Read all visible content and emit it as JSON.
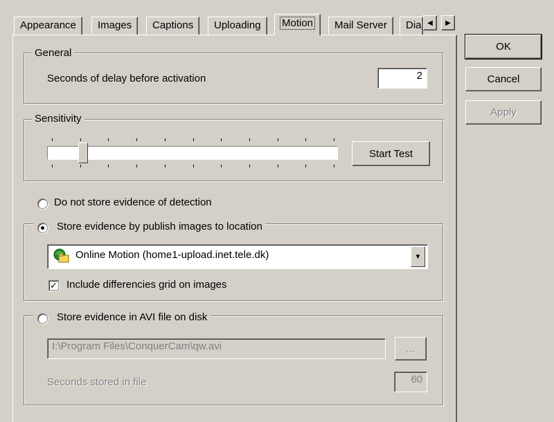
{
  "tabs": [
    {
      "label": "Appearance"
    },
    {
      "label": "Images"
    },
    {
      "label": "Captions"
    },
    {
      "label": "Uploading"
    },
    {
      "label": "Motion",
      "active": true
    },
    {
      "label": "Mail Server"
    },
    {
      "label": "Dia"
    }
  ],
  "tab_scroll": {
    "left_icon": "triangle-left-icon",
    "right_icon": "triangle-right-icon"
  },
  "general": {
    "title": "General",
    "delay_label": "Seconds of delay before activation",
    "delay_value": "2"
  },
  "sensitivity": {
    "title": "Sensitivity",
    "level": 0.1,
    "tick_count": 11,
    "start_test_label": "Start Test"
  },
  "evidence": {
    "no_store_label": "Do not store evidence of detection",
    "publish_label": "Store evidence by publish images to location",
    "selected": "publish",
    "location_value": "Online Motion (home1-upload.inet.tele.dk)",
    "location_icon": "network-folder-icon",
    "diff_grid_label": "Include differencies grid on images",
    "diff_grid_checked": true,
    "avi_label": "Store evidence in AVI file on disk",
    "avi_path": "I:\\Program Files\\ConquerCam\\qw.avi",
    "browse_label": "...",
    "seconds_label": "Seconds stored in file",
    "seconds_value": "60"
  },
  "buttons": {
    "ok": "OK",
    "cancel": "Cancel",
    "apply": "Apply"
  },
  "colors": {
    "face": "#d4d0c8",
    "shadow": "#808080",
    "highlight": "#ffffff",
    "disabled_text": "#808080"
  }
}
